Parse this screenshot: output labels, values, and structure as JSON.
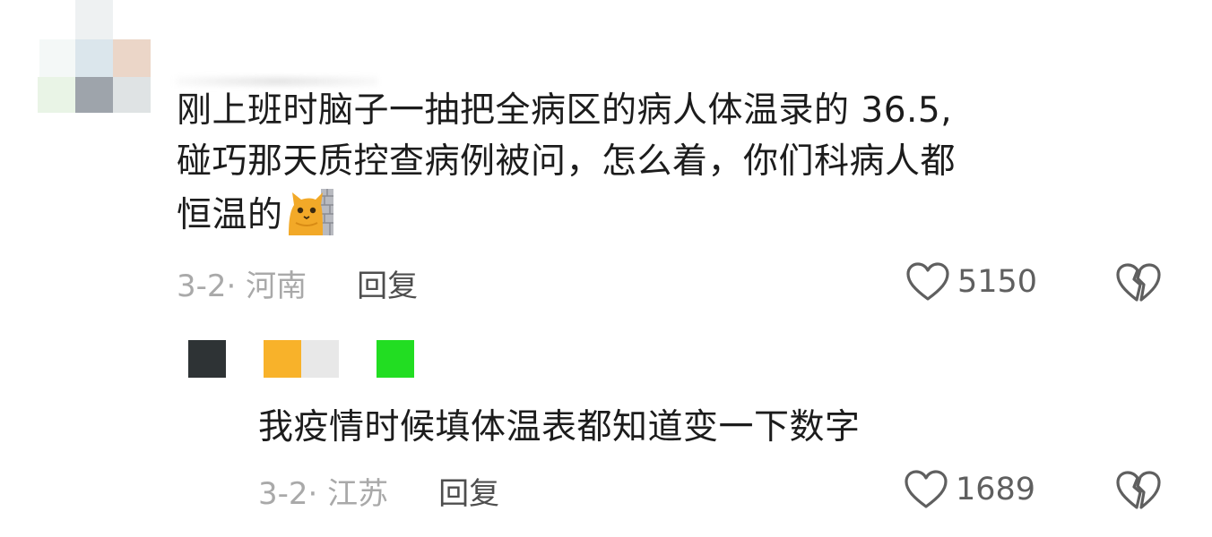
{
  "comment": {
    "lines": [
      "刚上班时脑子一抽把全病区的病人体温录的 36.5,",
      "碰巧那天质控查病例被问，怎么着，你们科病人都",
      "恒温的"
    ],
    "emoji": "cat-peeking-emoji",
    "date_location": "3-2· 河南",
    "reply_label": "回复",
    "likes": "5150",
    "avatar_colors": [
      "#f4f8f7",
      "#dbe6ec",
      "#ebd6c8",
      "#e9f4e6",
      "#9ea4ab",
      "#dfe3e4"
    ]
  },
  "reply": {
    "text": "我疫情时候填体温表都知道变一下数字",
    "date_location": "3-2· 江苏",
    "reply_label": "回复",
    "likes": "1689",
    "avatar_colors": [
      "#2e3335",
      "#f8b22a",
      "#e8e8e8",
      "#22dd22"
    ]
  },
  "icons": {
    "like": "heart-outline-icon",
    "dislike": "broken-heart-icon"
  }
}
